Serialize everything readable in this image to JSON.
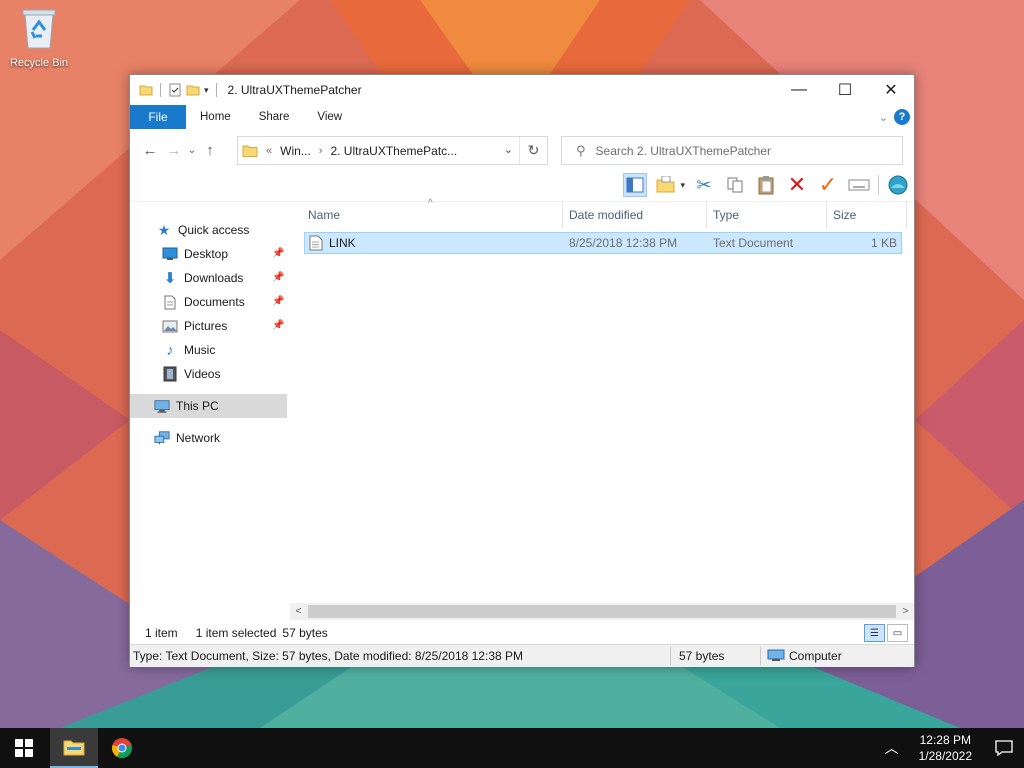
{
  "desktop": {
    "recycle_bin_label": "Recycle Bin"
  },
  "window": {
    "title": "2. UltraUXThemePatcher",
    "controls": {
      "minimize": "—",
      "maximize": "☐",
      "close": "✕"
    }
  },
  "ribbon": {
    "tabs": {
      "file": "File",
      "home": "Home",
      "share": "Share",
      "view": "View"
    },
    "help": "?"
  },
  "address_bar": {
    "prefix": "«",
    "crumb_parent": "Win...",
    "crumb_sep": "›",
    "crumb_current": "2. UltraUXThemePatc..."
  },
  "search": {
    "placeholder": "Search 2. UltraUXThemePatcher"
  },
  "navigation_pane": {
    "quick_access": "Quick access",
    "desktop": "Desktop",
    "downloads": "Downloads",
    "documents": "Documents",
    "pictures": "Pictures",
    "music": "Music",
    "videos": "Videos",
    "this_pc": "This PC",
    "network": "Network"
  },
  "file_list": {
    "columns": {
      "name": "Name",
      "date_modified": "Date modified",
      "type": "Type",
      "size": "Size"
    },
    "rows": [
      {
        "name": "LINK",
        "date_modified": "8/25/2018 12:38 PM",
        "type": "Text Document",
        "size": "1 KB"
      }
    ]
  },
  "status_bar": {
    "item_count": "1 item",
    "selected": "1 item selected",
    "selected_size": "57 bytes"
  },
  "details_bar": {
    "description": "Type: Text Document, Size: 57 bytes, Date modified: 8/25/2018 12:38 PM",
    "size": "57 bytes",
    "location": "Computer"
  },
  "taskbar": {
    "time": "12:28 PM",
    "date": "1/28/2022"
  },
  "colors": {
    "accent": "#1979ca",
    "selection": "#cce8ff",
    "taskbar": "#101010"
  }
}
